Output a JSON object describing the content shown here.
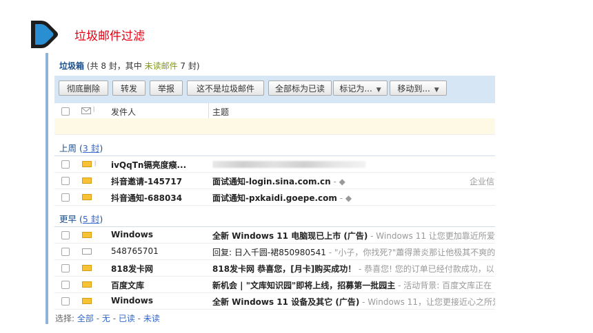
{
  "header": {
    "title": "垃圾邮件过滤"
  },
  "folder": {
    "name": "垃圾箱",
    "count_prefix": " (共 8 封，其中 ",
    "unread_label": "未读邮件",
    "count_suffix": " 7 封)"
  },
  "toolbar": {
    "delete": "彻底删除",
    "forward": "转发",
    "report": "举报",
    "not_spam": "这不是垃圾邮件",
    "mark_all_read": "全部标为已读",
    "mark_as": "标记为...",
    "move_to": "移动到..."
  },
  "columns": {
    "sender": "发件人",
    "subject": "主题"
  },
  "groups": {
    "last_week": {
      "label": "上周",
      "count": "3 封"
    },
    "earlier": {
      "label": "更早",
      "count": "5 封"
    }
  },
  "rows": [
    {
      "sender": "ivQqTn镉亮度瘊...",
      "subject": "",
      "preview": "",
      "tag": "",
      "unread": true,
      "opened": false,
      "attach": true
    },
    {
      "sender": "抖音邀请-145717",
      "subject": "面试通知-login.sina.com.cn",
      "preview": " - ◆",
      "tag": "企业信",
      "unread": true,
      "opened": false,
      "attach": false
    },
    {
      "sender": "抖音通知-688034",
      "subject": "面试通知-pxkaidi.goepe.com",
      "preview": " - ◆",
      "tag": "",
      "unread": true,
      "opened": false,
      "attach": false
    },
    {
      "sender": "Windows",
      "subject": "全新 Windows 11 电脑现已上市 (广告)",
      "preview": " - Windows 11 让您更加靠近所爱",
      "tag": "",
      "unread": true,
      "opened": false,
      "attach": false
    },
    {
      "sender": "548765701",
      "subject": "回复: 日入千圆-裙850980541",
      "preview": " - \"小子，你找死?\"蕭得萧炎那让他极其不爽的",
      "tag": "",
      "unread": false,
      "opened": true,
      "attach": false
    },
    {
      "sender": "818发卡网",
      "subject": "818发卡网 恭喜您，[月卡]购买成功！",
      "preview": " - 恭喜您! 您的订单已经付款成功，以",
      "tag": "",
      "unread": true,
      "opened": false,
      "attach": false
    },
    {
      "sender": "百度文库",
      "subject": "新机会 | \"文库知识园\"即将上线，招募第一批园主",
      "preview": " - 活动背景: 百度文库正在",
      "tag": "",
      "unread": true,
      "opened": false,
      "attach": false
    },
    {
      "sender": "Windows",
      "subject": "全新 Windows 11 设备及其它 (广告)",
      "preview": " - Windows 11，让您更接近心之所爱",
      "tag": "",
      "unread": true,
      "opened": false,
      "attach": false
    }
  ],
  "footer": {
    "select_label": "选择:",
    "all": "全部",
    "none": "无",
    "read": "已读",
    "unread": "未读",
    "sep": " - "
  },
  "colors": {
    "title_red": "#e60012",
    "toolbar_bg": "#d7e6f5",
    "link_blue": "#3366cc",
    "unread_green": "#7f9a0b"
  }
}
